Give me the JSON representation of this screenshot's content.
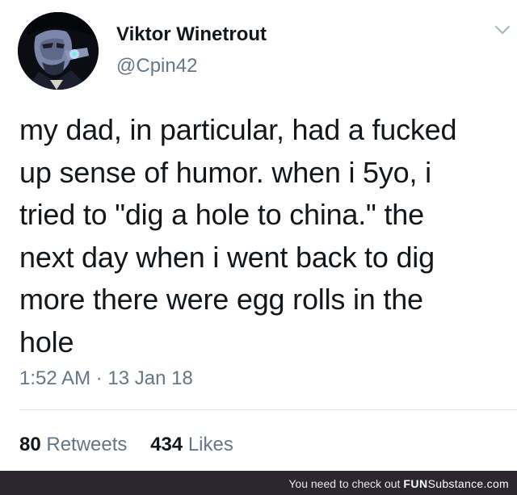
{
  "tweet": {
    "display_name": "Viktor Winetrout",
    "handle": "@Cpin42",
    "text": "my dad, in particular, had a fucked\nup sense of humor. when i 5yo, i\ntried to \"dig a hole to china.\" the\nnext day when i went back to dig\nmore there were egg rolls in the\nhole",
    "timestamp": "1:52 AM · 13 Jan 18",
    "retweets_count": "80",
    "retweets_label": "Retweets",
    "likes_count": "434",
    "likes_label": "Likes",
    "menu_icon": "chevron-down-icon",
    "avatar_icon": "avatar-illustration"
  },
  "footer": {
    "prefix": "You need to check out ",
    "brand_bold": "FUN",
    "brand_light": "Substance",
    "suffix": ".com"
  },
  "colors": {
    "text_primary": "#14171a",
    "text_secondary": "#657786",
    "divider": "#e1e8ed",
    "footer_bg": "#2b2731"
  }
}
